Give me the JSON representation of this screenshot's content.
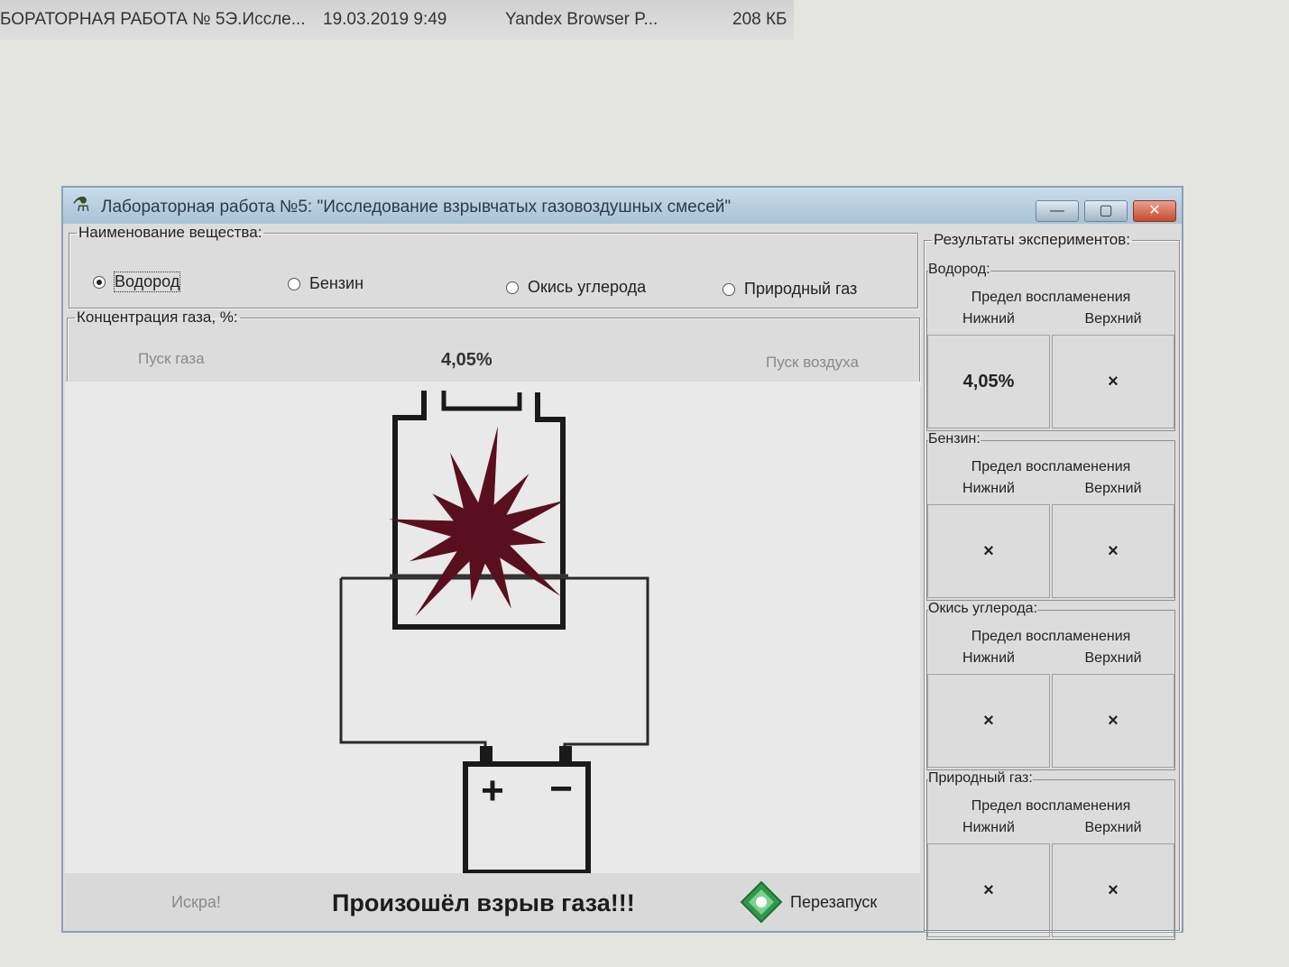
{
  "background_file": {
    "name": "БОРАТОРНАЯ РАБОТА № 5Э.Иссле...",
    "date": "19.03.2019 9:49",
    "app": "Yandex Browser P...",
    "size": "208 КБ"
  },
  "window": {
    "title": "Лабораторная работа №5: \"Исследование взрывчатых газовоздушных смесей\"",
    "minimize_glyph": "—",
    "maximize_glyph": "▢",
    "close_glyph": "✕"
  },
  "substance": {
    "legend": "Наименование вещества:",
    "options": [
      {
        "label": "Водород",
        "selected": true
      },
      {
        "label": "Бензин",
        "selected": false
      },
      {
        "label": "Окись углерода",
        "selected": false
      },
      {
        "label": "Природный газ",
        "selected": false
      }
    ]
  },
  "concentration": {
    "legend": "Концентрация газа, %:",
    "gas_start_label": "Пуск газа",
    "value": "4,05%",
    "air_start_label": "Пуск воздуха"
  },
  "simulation": {
    "battery_plus": "+",
    "battery_minus": "−",
    "explosion_color": "#5a0f1e"
  },
  "bottom": {
    "spark_label": "Искра!",
    "status": "Произошёл взрыв газа!!!",
    "restart_label": "Перезапуск"
  },
  "results": {
    "legend": "Результаты экспериментов:",
    "groups": [
      {
        "name": "Водород:",
        "header": "Предел воспламенения",
        "lower_label": "Нижний",
        "upper_label": "Верхний",
        "lower": "4,05%",
        "upper": "×"
      },
      {
        "name": "Бензин:",
        "header": "Предел воспламенения",
        "lower_label": "Нижний",
        "upper_label": "Верхний",
        "lower": "×",
        "upper": "×"
      },
      {
        "name": "Окись углерода:",
        "header": "Предел воспламенения",
        "lower_label": "Нижний",
        "upper_label": "Верхний",
        "lower": "×",
        "upper": "×"
      },
      {
        "name": "Природный газ:",
        "header": "Предел воспламенения",
        "lower_label": "Нижний",
        "upper_label": "Верхний",
        "lower": "×",
        "upper": "×"
      }
    ]
  }
}
